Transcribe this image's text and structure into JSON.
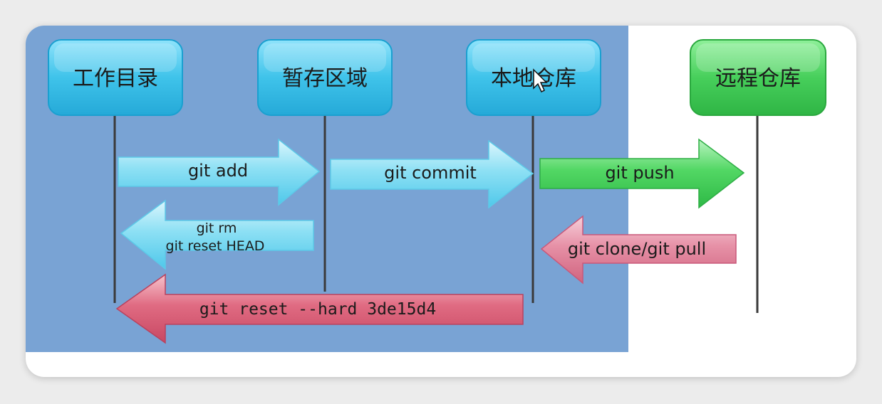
{
  "diagram": {
    "boxes": {
      "working_dir": "工作目录",
      "staging_area": "暂存区域",
      "local_repo": "本地仓库",
      "remote_repo": "远程仓库"
    },
    "arrows": {
      "add": "git add",
      "commit": "git commit",
      "push": "git push",
      "rm_line1": "git rm",
      "rm_line2": "git reset HEAD",
      "clone_pull": "git clone/git pull",
      "reset_hard": "git reset --hard 3de15d4"
    }
  },
  "colors": {
    "panel_blue": "#79a3d4",
    "box_blue": "#3cc4ea",
    "box_green": "#45cf5a",
    "arrow_cyan": "#74d8f0",
    "arrow_green": "#3fcc55",
    "arrow_pink": "#e2859c",
    "arrow_red": "#de6177"
  },
  "cursor": "arrow-cursor-icon"
}
